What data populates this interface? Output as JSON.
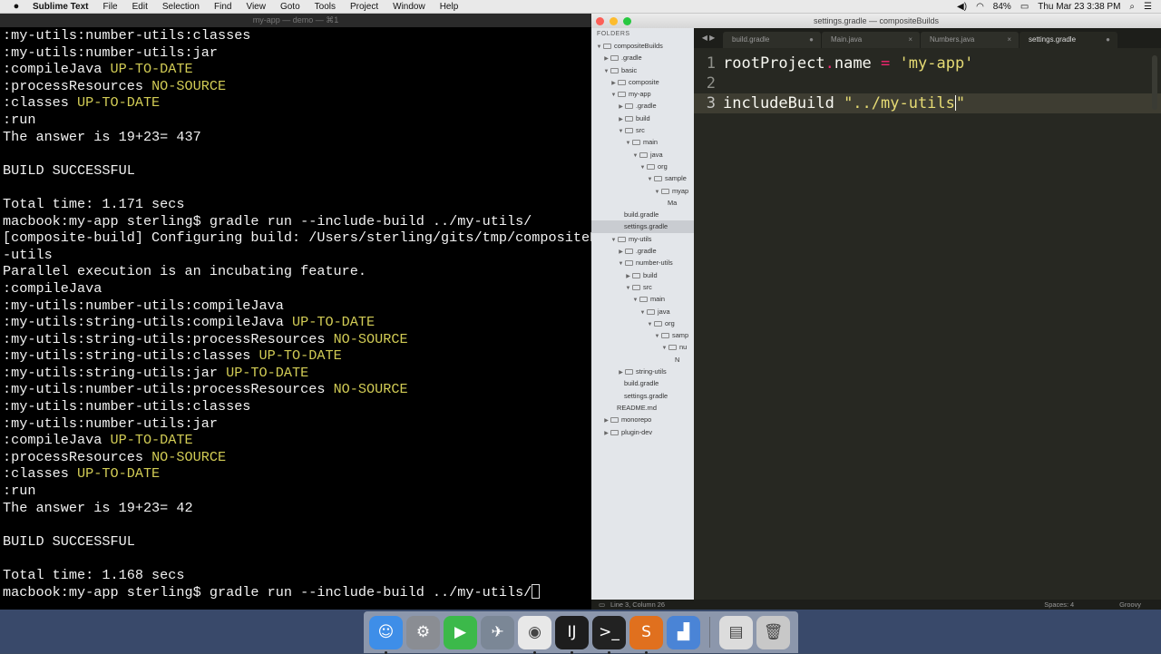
{
  "menubar": {
    "app_name": "Sublime Text",
    "items": [
      "File",
      "Edit",
      "Selection",
      "Find",
      "View",
      "Goto",
      "Tools",
      "Project",
      "Window",
      "Help"
    ],
    "battery": "84%",
    "clock": "Thu Mar 23  3:38 PM"
  },
  "terminal": {
    "title": "my-app — demo — ⌘1",
    "lines": [
      {
        "text": ":my-utils:number-utils:classes",
        "status": ""
      },
      {
        "text": ":my-utils:number-utils:jar",
        "status": ""
      },
      {
        "text": ":compileJava ",
        "status": "UP-TO-DATE"
      },
      {
        "text": ":processResources ",
        "status": "NO-SOURCE"
      },
      {
        "text": ":classes ",
        "status": "UP-TO-DATE"
      },
      {
        "text": ":run",
        "status": ""
      },
      {
        "text": "The answer is 19+23= 437",
        "status": ""
      },
      {
        "text": "",
        "status": ""
      },
      {
        "text": "BUILD SUCCESSFUL",
        "status": ""
      },
      {
        "text": "",
        "status": ""
      },
      {
        "text": "Total time: 1.171 secs",
        "status": ""
      },
      {
        "text": "macbook:my-app sterling$ gradle run --include-build ../my-utils/",
        "status": ""
      },
      {
        "text": "[composite-build] Configuring build: /Users/sterling/gits/tmp/compositeBuil",
        "status": ""
      },
      {
        "text": "-utils",
        "status": ""
      },
      {
        "text": "Parallel execution is an incubating feature.",
        "status": ""
      },
      {
        "text": ":compileJava",
        "status": ""
      },
      {
        "text": ":my-utils:number-utils:compileJava",
        "status": ""
      },
      {
        "text": ":my-utils:string-utils:compileJava ",
        "status": "UP-TO-DATE"
      },
      {
        "text": ":my-utils:string-utils:processResources ",
        "status": "NO-SOURCE"
      },
      {
        "text": ":my-utils:string-utils:classes ",
        "status": "UP-TO-DATE"
      },
      {
        "text": ":my-utils:string-utils:jar ",
        "status": "UP-TO-DATE"
      },
      {
        "text": ":my-utils:number-utils:processResources ",
        "status": "NO-SOURCE"
      },
      {
        "text": ":my-utils:number-utils:classes",
        "status": ""
      },
      {
        "text": ":my-utils:number-utils:jar",
        "status": ""
      },
      {
        "text": ":compileJava ",
        "status": "UP-TO-DATE"
      },
      {
        "text": ":processResources ",
        "status": "NO-SOURCE"
      },
      {
        "text": ":classes ",
        "status": "UP-TO-DATE"
      },
      {
        "text": ":run",
        "status": ""
      },
      {
        "text": "The answer is 19+23= 42",
        "status": ""
      },
      {
        "text": "",
        "status": ""
      },
      {
        "text": "BUILD SUCCESSFUL",
        "status": ""
      },
      {
        "text": "",
        "status": ""
      },
      {
        "text": "Total time: 1.168 secs",
        "status": ""
      },
      {
        "text": "macbook:my-app sterling$ gradle run --include-build ../my-utils/",
        "status": "",
        "cursor": true
      }
    ]
  },
  "sublime": {
    "window_title": "settings.gradle — compositeBuilds",
    "folders_label": "FOLDERS",
    "tree": [
      {
        "label": "compositeBuilds",
        "depth": 0,
        "open": true
      },
      {
        "label": ".gradle",
        "depth": 1,
        "open": false
      },
      {
        "label": "basic",
        "depth": 1,
        "open": true
      },
      {
        "label": "composite",
        "depth": 2,
        "open": false
      },
      {
        "label": "my-app",
        "depth": 2,
        "open": true
      },
      {
        "label": ".gradle",
        "depth": 3,
        "open": false
      },
      {
        "label": "build",
        "depth": 3,
        "open": false
      },
      {
        "label": "src",
        "depth": 3,
        "open": true
      },
      {
        "label": "main",
        "depth": 4,
        "open": true
      },
      {
        "label": "java",
        "depth": 5,
        "open": true
      },
      {
        "label": "org",
        "depth": 6,
        "open": true
      },
      {
        "label": "sample",
        "depth": 7,
        "open": true
      },
      {
        "label": "myap",
        "depth": 8,
        "open": true
      },
      {
        "label": "Ma",
        "depth": 9,
        "file": true
      },
      {
        "label": "build.gradle",
        "depth": 3,
        "file": true
      },
      {
        "label": "settings.gradle",
        "depth": 3,
        "file": true,
        "selected": true
      },
      {
        "label": "my-utils",
        "depth": 2,
        "open": true
      },
      {
        "label": ".gradle",
        "depth": 3,
        "open": false
      },
      {
        "label": "number-utils",
        "depth": 3,
        "open": true
      },
      {
        "label": "build",
        "depth": 4,
        "open": false
      },
      {
        "label": "src",
        "depth": 4,
        "open": true
      },
      {
        "label": "main",
        "depth": 5,
        "open": true
      },
      {
        "label": "java",
        "depth": 6,
        "open": true
      },
      {
        "label": "org",
        "depth": 7,
        "open": true
      },
      {
        "label": "samp",
        "depth": 8,
        "open": true
      },
      {
        "label": "nu",
        "depth": 9,
        "open": true
      },
      {
        "label": "N",
        "depth": 10,
        "file": true
      },
      {
        "label": "string-utils",
        "depth": 3,
        "open": false
      },
      {
        "label": "build.gradle",
        "depth": 3,
        "file": true
      },
      {
        "label": "settings.gradle",
        "depth": 3,
        "file": true
      },
      {
        "label": "README.md",
        "depth": 2,
        "file": true
      },
      {
        "label": "monorepo",
        "depth": 1,
        "open": false
      },
      {
        "label": "plugin-dev",
        "depth": 1,
        "open": false
      }
    ],
    "tabs": [
      {
        "label": "build.gradle",
        "active": false,
        "mark": "●"
      },
      {
        "label": "Main.java",
        "active": false,
        "mark": "×"
      },
      {
        "label": "Numbers.java",
        "active": false,
        "mark": "×"
      },
      {
        "label": "settings.gradle",
        "active": true,
        "mark": "●"
      }
    ],
    "code": [
      {
        "num": "1",
        "parts": [
          {
            "t": "rootProject",
            "c": ""
          },
          {
            "t": ".",
            "c": "op"
          },
          {
            "t": "name ",
            "c": ""
          },
          {
            "t": "=",
            "c": "op"
          },
          {
            "t": " ",
            "c": ""
          },
          {
            "t": "'my-app'",
            "c": "str"
          }
        ]
      },
      {
        "num": "2",
        "parts": []
      },
      {
        "num": "3",
        "current": true,
        "parts": [
          {
            "t": "includeBuild ",
            "c": ""
          },
          {
            "t": "\"../my-utils",
            "c": "str"
          },
          {
            "t": "|",
            "c": "cursor"
          },
          {
            "t": "\"",
            "c": "str"
          }
        ]
      }
    ],
    "status": {
      "position": "Line 3, Column 26",
      "spaces": "Spaces: 4",
      "syntax": "Groovy"
    }
  },
  "dock": {
    "apps": [
      {
        "name": "finder",
        "color": "#3e8ee8",
        "glyph": "☺",
        "running": true
      },
      {
        "name": "system-preferences",
        "color": "#8a8d93",
        "glyph": "⚙",
        "running": false
      },
      {
        "name": "facetime",
        "color": "#3cb94a",
        "glyph": "▶",
        "running": false
      },
      {
        "name": "launchpad",
        "color": "#7b8796",
        "glyph": "✈",
        "running": false
      },
      {
        "name": "chrome",
        "color": "#e8e8e8",
        "glyph": "◉",
        "running": true
      },
      {
        "name": "intellij",
        "color": "#1d1d1d",
        "glyph": "IJ",
        "running": true
      },
      {
        "name": "terminal",
        "color": "#222222",
        "glyph": ">_",
        "running": true
      },
      {
        "name": "sublime-text",
        "color": "#e0701e",
        "glyph": "S",
        "running": true
      },
      {
        "name": "keynote",
        "color": "#4a84d6",
        "glyph": "▟",
        "running": false
      }
    ],
    "right_items": [
      {
        "name": "documents-stack",
        "color": "#dcdcdc",
        "glyph": "▤"
      },
      {
        "name": "trash",
        "color": "#c8c8c8",
        "glyph": "🗑"
      }
    ]
  }
}
